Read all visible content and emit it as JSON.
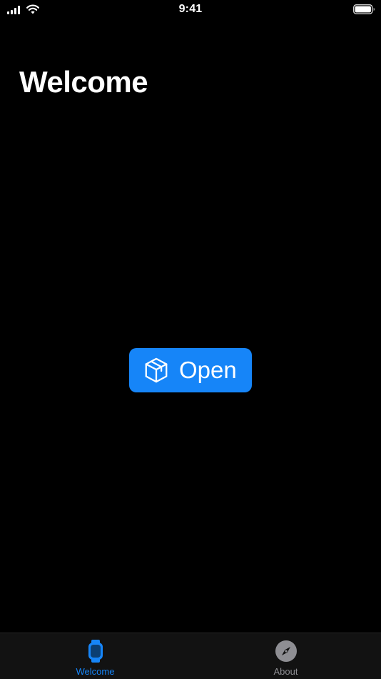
{
  "status_bar": {
    "time": "9:41"
  },
  "header": {
    "title": "Welcome"
  },
  "main": {
    "open_button": {
      "label": "Open",
      "icon": "box-icon"
    }
  },
  "tab_bar": {
    "tabs": [
      {
        "label": "Welcome",
        "icon": "watch-icon",
        "selected": true
      },
      {
        "label": "About",
        "icon": "compass-icon",
        "selected": false
      }
    ]
  },
  "colors": {
    "accent": "#1685f8",
    "background": "#000000",
    "tab_bar": "#121212",
    "inactive": "#8e8e93"
  }
}
